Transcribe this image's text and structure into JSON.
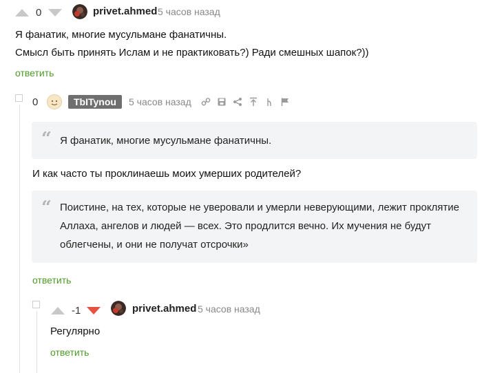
{
  "comment1": {
    "score": "0",
    "username": "privet.ahmed",
    "time": "5 часов назад",
    "lines": [
      "Я фанатик, многие мусульмане фанатичны.",
      "Смысл быть принять Ислам и не практиковать?) Ради смешных шапок?))"
    ],
    "reply": "ответить"
  },
  "comment2": {
    "score": "0",
    "username": "TbITynou",
    "time": "5 часов назад",
    "quote1": "Я фанатик, многие мусульмане фанатичны.",
    "text": "И как часто ты проклинаешь моих умерших родителей?",
    "quote2": "Поистине, на тех, которые не уверовали и умерли неверующими, лежит проклятие Аллаха, ангелов и людей — всех. Это продлится вечно. Их мучения не будут облегчены, и они не получат отсрочки»",
    "reply": "ответить",
    "tools": [
      "link-icon",
      "save-icon",
      "share-icon",
      "scroll-up-icon",
      "branch-icon",
      "flag-icon"
    ]
  },
  "comment3": {
    "score": "-1",
    "username": "privet.ahmed",
    "time": "5 часов назад",
    "text": "Регулярно",
    "reply": "ответить"
  },
  "colors": {
    "reply": "#4f9a27",
    "downvote_active": "#e55340",
    "badge": "#6f6f6f"
  }
}
